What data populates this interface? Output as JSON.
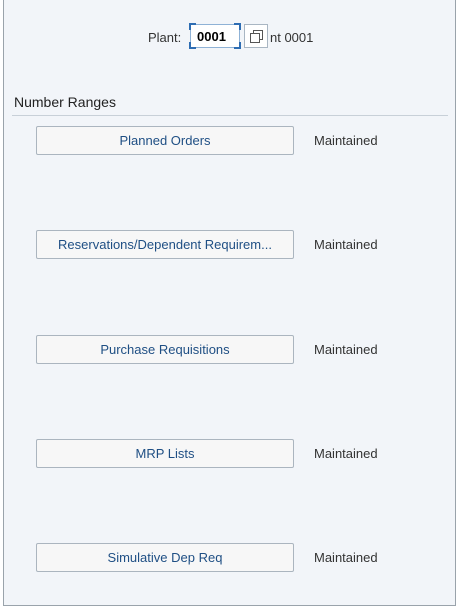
{
  "plant": {
    "label": "Plant:",
    "value": "0001",
    "description": "nt 0001",
    "help_icon": "value-help-icon"
  },
  "section": {
    "title": "Number Ranges"
  },
  "number_ranges": [
    {
      "label": "Planned Orders",
      "status": "Maintained"
    },
    {
      "label": "Reservations/Dependent Requirem...",
      "status": "Maintained"
    },
    {
      "label": "Purchase Requisitions",
      "status": "Maintained"
    },
    {
      "label": "MRP Lists",
      "status": "Maintained"
    },
    {
      "label": "Simulative Dep Req",
      "status": "Maintained"
    }
  ]
}
